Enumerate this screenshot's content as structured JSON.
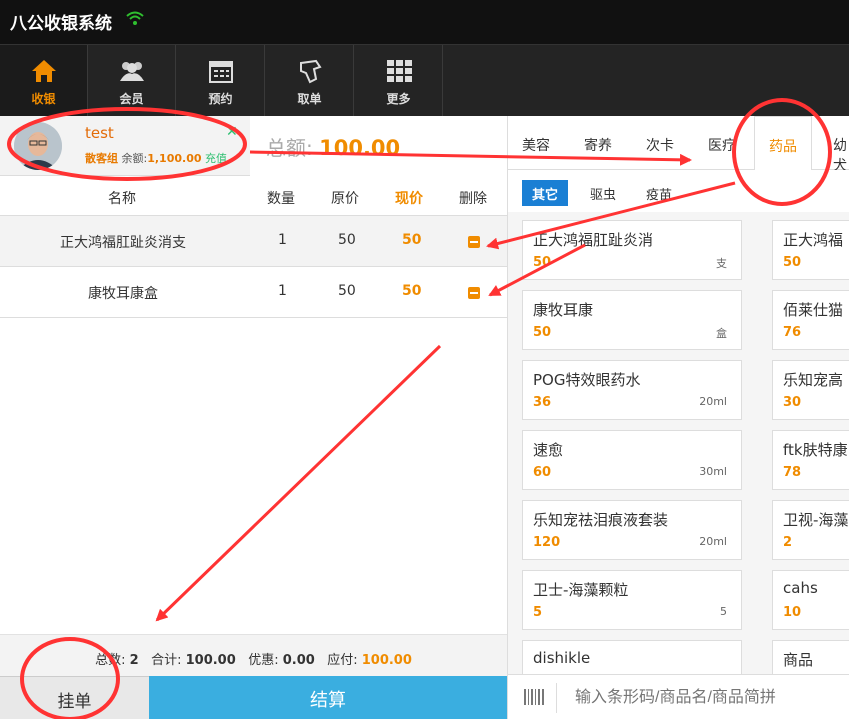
{
  "app": {
    "title": "八公收银系统"
  },
  "toolbar": [
    {
      "label": "收银",
      "icon": "home-icon",
      "active": true
    },
    {
      "label": "会员",
      "icon": "members-icon"
    },
    {
      "label": "预约",
      "icon": "calendar-icon"
    },
    {
      "label": "取单",
      "icon": "hand-icon"
    },
    {
      "label": "更多",
      "icon": "grid-icon"
    }
  ],
  "member": {
    "name": "test",
    "group": "散客组",
    "balance_label": "余额:",
    "balance": "1,100.00",
    "recharge": "充值"
  },
  "total": {
    "label": "总额:",
    "value": "100.00"
  },
  "cart": {
    "headers": {
      "name": "名称",
      "qty": "数量",
      "orig": "原价",
      "now": "现价",
      "del": "删除"
    },
    "rows": [
      {
        "name": "正大鸿福肛趾炎消支",
        "qty": "1",
        "orig": "50",
        "now": "50"
      },
      {
        "name": "康牧耳康盒",
        "qty": "1",
        "orig": "50",
        "now": "50"
      }
    ]
  },
  "summary": {
    "count_label": "总数:",
    "count": "2",
    "sum_label": "合计:",
    "sum": "100.00",
    "discount_label": "优惠:",
    "discount": "0.00",
    "pay_label": "应付:",
    "pay": "100.00"
  },
  "buttons": {
    "hang": "挂单",
    "pay": "结算"
  },
  "category_tabs": [
    "美容",
    "寄养",
    "次卡",
    "医疗",
    "药品",
    "幼犬"
  ],
  "active_tab": "药品",
  "subtabs": [
    "其它",
    "驱虫",
    "疫苗"
  ],
  "products_left": [
    {
      "name": "正大鸿福肛趾炎消",
      "price": "50",
      "unit": "支"
    },
    {
      "name": "康牧耳康",
      "price": "50",
      "unit": "盒"
    },
    {
      "name": "POG特效眼药水",
      "price": "36",
      "unit": "20ml"
    },
    {
      "name": "速愈",
      "price": "60",
      "unit": "30ml"
    },
    {
      "name": "乐知宠祛泪痕液套装",
      "price": "120",
      "unit": "20ml"
    },
    {
      "name": "卫士-海藻颗粒",
      "price": "5",
      "unit": "5"
    },
    {
      "name": "dishikle",
      "price": "",
      "unit": ""
    }
  ],
  "products_right": [
    {
      "name": "正大鸿福",
      "price": "50"
    },
    {
      "name": "佰莱仕猫",
      "price": "76"
    },
    {
      "name": "乐知宠高",
      "price": "30"
    },
    {
      "name": "ftk肤特康",
      "price": "78"
    },
    {
      "name": "卫视-海藻",
      "price": "2"
    },
    {
      "name": "cahs",
      "price": "10"
    },
    {
      "name": "商品",
      "price": ""
    }
  ],
  "search": {
    "placeholder": "输入条形码/商品名/商品简拼"
  },
  "colors": {
    "accent": "#f08c00",
    "pay": "#3aaee0",
    "annotation": "#ff3333",
    "active_subtab": "#1a7fd4"
  }
}
